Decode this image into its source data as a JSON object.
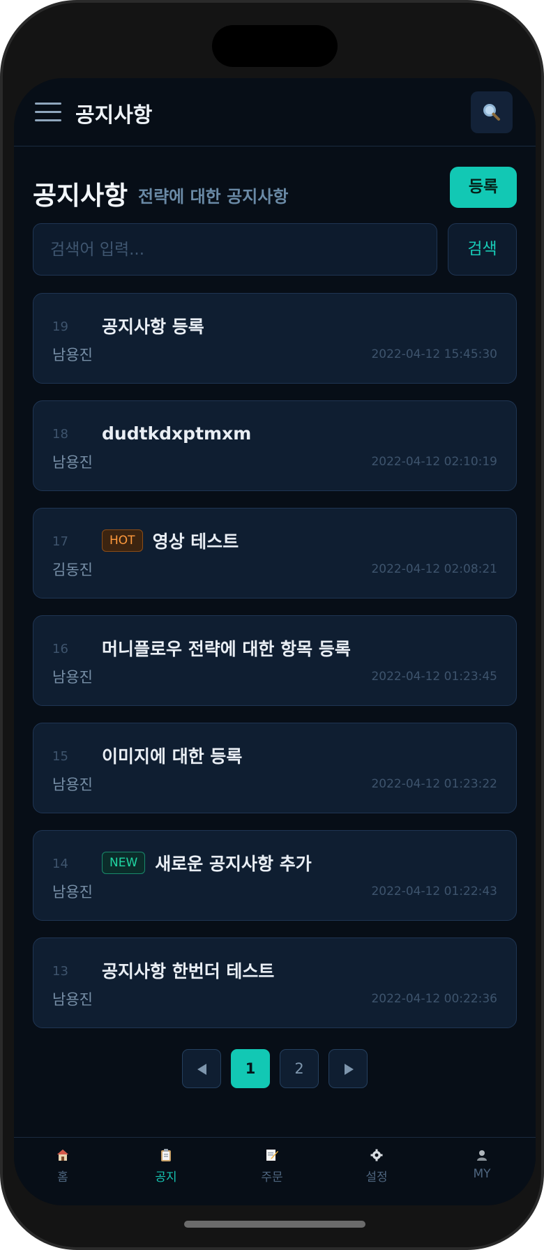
{
  "header": {
    "title": "공지사항"
  },
  "page": {
    "heading": "공지사항",
    "subheading": "전략에 대한 공지사항",
    "register_label": "등록"
  },
  "search": {
    "placeholder": "검색어 입력...",
    "button_label": "검색"
  },
  "notices": [
    {
      "num": "19",
      "badge": "",
      "title": "공지사항 등록",
      "author": "남용진",
      "date": "2022-04-12 15:45:30"
    },
    {
      "num": "18",
      "badge": "",
      "title": "dudtkdxptmxm",
      "author": "남용진",
      "date": "2022-04-12 02:10:19"
    },
    {
      "num": "17",
      "badge": "HOT",
      "title": "영상 테스트",
      "author": "김동진",
      "date": "2022-04-12 02:08:21"
    },
    {
      "num": "16",
      "badge": "",
      "title": "머니플로우 전략에 대한 항목 등록",
      "author": "남용진",
      "date": "2022-04-12 01:23:45"
    },
    {
      "num": "15",
      "badge": "",
      "title": "이미지에 대한 등록",
      "author": "남용진",
      "date": "2022-04-12 01:23:22"
    },
    {
      "num": "14",
      "badge": "NEW",
      "title": "새로운 공지사항 추가",
      "author": "남용진",
      "date": "2022-04-12 01:22:43"
    },
    {
      "num": "13",
      "badge": "",
      "title": "공지사항 한번더 테스트",
      "author": "남용진",
      "date": "2022-04-12 00:22:36"
    }
  ],
  "pagination": {
    "pages": [
      "1",
      "2"
    ],
    "current": "1"
  },
  "nav": [
    {
      "label": "홈",
      "icon": "home-icon"
    },
    {
      "label": "공지",
      "icon": "clipboard-icon"
    },
    {
      "label": "주문",
      "icon": "memo-icon"
    },
    {
      "label": "설정",
      "icon": "gear-icon"
    },
    {
      "label": "MY",
      "icon": "user-icon"
    }
  ],
  "colors": {
    "accent": "#12c8b4",
    "background": "#070e17",
    "card": "#0f1e31",
    "hot": "#ff9a3d",
    "new": "#20d6a3"
  }
}
